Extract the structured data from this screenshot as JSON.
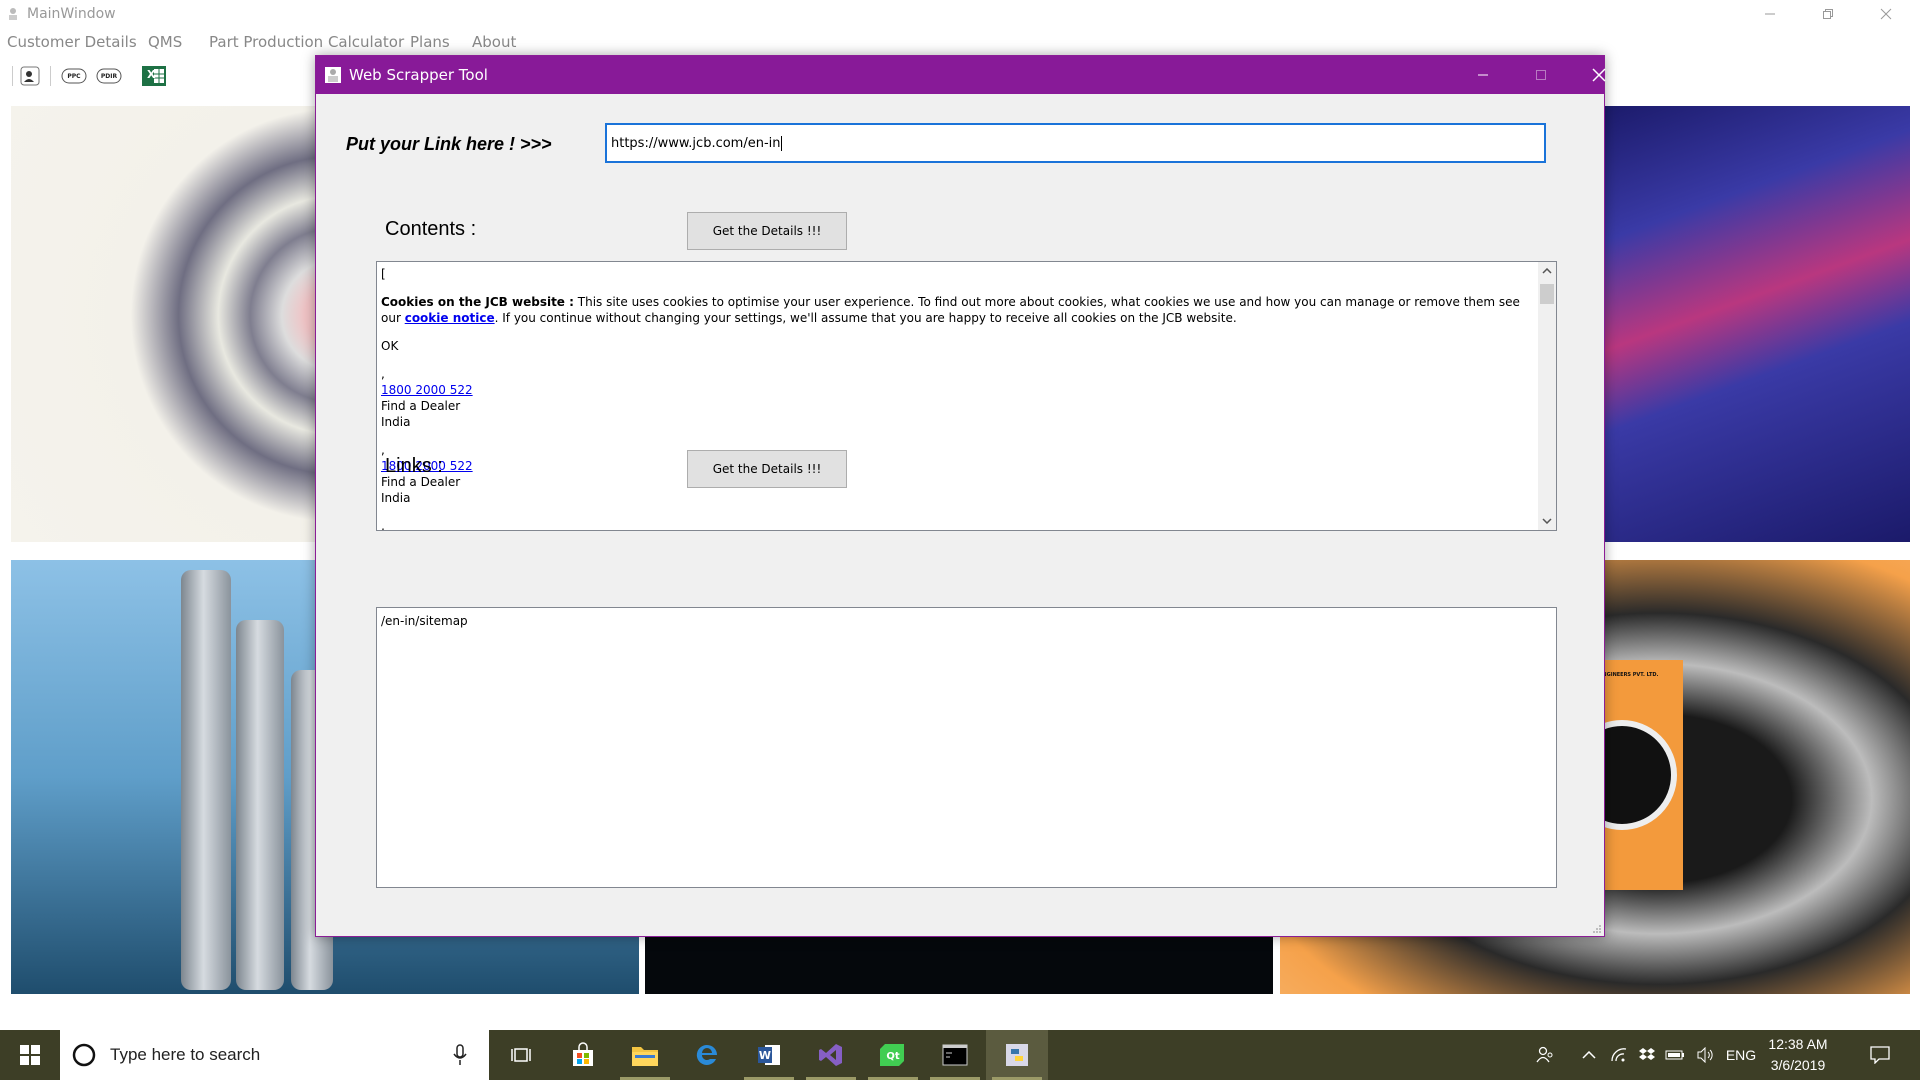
{
  "main_window": {
    "title": "MainWindow",
    "menu": [
      "Customer Details",
      "QMS",
      "Part Production Calculator",
      "Plans",
      "About"
    ],
    "toolbar": {
      "ppc_label": "PPC",
      "pdir_label": "PDIR",
      "excel_label": "X"
    }
  },
  "brochure": {
    "company": "ENGINEERS PVT. LTD."
  },
  "dialog": {
    "title": "Web Scrapper Tool",
    "link_label": "Put your Link here ! >>>",
    "url_value": "https://www.jcb.com/en-in",
    "contents_label": "Contents :",
    "contents_button": "Get the Details !!!",
    "links_label": "Links :",
    "links_button": "Get the Details !!!",
    "contents": {
      "open_bracket": "[",
      "cookie_heading": "Cookies on the JCB website :",
      "cookie_text_1": " This site uses cookies to optimise your user experience. To find out more about cookies, what cookies we use and how you can manage or remove them see our ",
      "cookie_link": "cookie notice",
      "cookie_text_2": ". If you continue without changing your settings, we'll assume that you are happy to receive all cookies on the JCB website.",
      "ok": "OK",
      "comma": ",",
      "phone": "1800 2000 522 ",
      "find_dealer": "Find a Dealer",
      "country": "India"
    },
    "links_text": "/en-in/sitemap"
  },
  "taskbar": {
    "search_placeholder": "Type here to search",
    "language": "ENG",
    "time": "12:38 AM",
    "date": "3/6/2019",
    "colors": {
      "background": "#3d3e26",
      "accent": "#881a98"
    }
  }
}
